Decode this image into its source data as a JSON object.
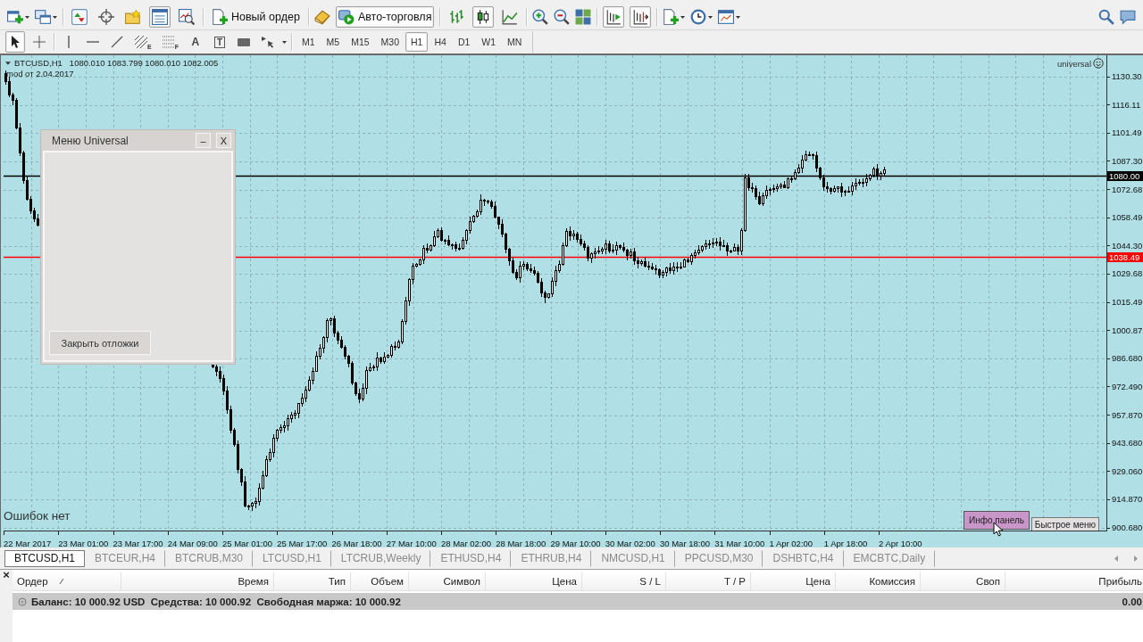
{
  "toolbar": {
    "view_toggles": [
      {
        "on": false
      },
      {
        "on": false
      },
      {
        "on": false
      },
      {
        "on": true
      },
      {
        "on": false
      }
    ],
    "new_order": "Новый ордер",
    "auto_trading": {
      "label": "Авто-торговля",
      "on": true
    },
    "chart_types": [
      {
        "selected": false
      },
      {
        "selected": true
      },
      {
        "selected": false
      }
    ],
    "autoscroll": {
      "on": true
    },
    "chart_shift": {
      "on": true
    }
  },
  "drawing_toolbar": {
    "tools": [
      {
        "selected": true
      },
      {
        "selected": false
      },
      {
        "selected": false
      },
      {
        "selected": false
      },
      {
        "selected": false
      },
      {
        "selected": false,
        "subscript": "E"
      },
      {
        "selected": false,
        "subscript": "F"
      },
      {
        "selected": false,
        "glyph": "A"
      },
      {
        "selected": false,
        "glyph": "T"
      },
      {
        "selected": false
      },
      {
        "selected": false
      }
    ],
    "timeframes": [
      {
        "label": "M1",
        "selected": false
      },
      {
        "label": "M5",
        "selected": false
      },
      {
        "label": "M15",
        "selected": false
      },
      {
        "label": "M30",
        "selected": false
      },
      {
        "label": "H1",
        "selected": true
      },
      {
        "label": "H4",
        "selected": false
      },
      {
        "label": "D1",
        "selected": false
      },
      {
        "label": "W1",
        "selected": false
      },
      {
        "label": "MN",
        "selected": false
      }
    ]
  },
  "chart": {
    "symbol": "BTCUSD,H1",
    "ohlc": "1080.010 1083.799 1080.010 1082.005",
    "comment": "mod от 2.04.2017",
    "expert": "universal",
    "status": "Ошибок нет",
    "panel": {
      "title": "Меню Universal",
      "minimize": "–",
      "close": "X",
      "button": "Закрыть отложки"
    },
    "buttons": [
      {
        "label": "Инфо панель",
        "color": "#c896c8"
      },
      {
        "label": "Быстрое меню",
        "color": "#e2e0e0"
      }
    ],
    "levels": [
      {
        "tag": "1080.00",
        "color": "#000000"
      },
      {
        "tag": "1038.49",
        "color": "#ff0000"
      }
    ],
    "price_labels": [
      "1130.30",
      "1116.11",
      "1101.49",
      "1087.30",
      "1072.68",
      "1058.49",
      "1044.30",
      "1029.68",
      "1015.49",
      "1000.87",
      "986.680",
      "972.490",
      "957.870",
      "943.680",
      "929.060",
      "914.870",
      "900.680"
    ],
    "time_labels": [
      "22 Mar 2017",
      "23 Mar 01:00",
      "23 Mar 17:00",
      "24 Mar 09:00",
      "25 Mar 01:00",
      "25 Mar 17:00",
      "26 Mar 18:00",
      "27 Mar 10:00",
      "28 Mar 02:00",
      "28 Mar 18:00",
      "29 Mar 10:00",
      "30 Mar 02:00",
      "30 Mar 18:00",
      "31 Mar 10:00",
      "1 Apr 02:00",
      "1 Apr 18:00",
      "2 Apr 10:00"
    ]
  },
  "chart_tabs": [
    {
      "label": "BTCUSD,H1",
      "selected": true
    },
    {
      "label": "BTCEUR,H4",
      "selected": false
    },
    {
      "label": "BTCRUB,M30",
      "selected": false
    },
    {
      "label": "LTCUSD,H1",
      "selected": false
    },
    {
      "label": "LTCRUB,Weekly",
      "selected": false
    },
    {
      "label": "ETHUSD,H4",
      "selected": false
    },
    {
      "label": "ETHRUB,H4",
      "selected": false
    },
    {
      "label": "NMCUSD,H1",
      "selected": false
    },
    {
      "label": "PPCUSD,M30",
      "selected": false
    },
    {
      "label": "DSHBTC,H4",
      "selected": false
    },
    {
      "label": "EMCBTC,Daily",
      "selected": false
    }
  ],
  "terminal": {
    "close": "×",
    "columns": [
      {
        "label": "Ордер",
        "sorted": true
      },
      {
        "label": "Время",
        "sorted": false
      },
      {
        "label": "Тип",
        "sorted": false
      },
      {
        "label": "Объем",
        "sorted": false
      },
      {
        "label": "Символ",
        "sorted": false
      },
      {
        "label": "Цена",
        "sorted": false
      },
      {
        "label": "S / L",
        "sorted": false
      },
      {
        "label": "T / P",
        "sorted": false
      },
      {
        "label": "Цена",
        "sorted": false
      },
      {
        "label": "Комиссия",
        "sorted": false
      },
      {
        "label": "Своп",
        "sorted": false
      },
      {
        "label": "Прибыль",
        "sorted": false
      }
    ],
    "balance": "Баланс: 10 000.92 USD  Средства: 10 000.92  Свободная маржа: 10 000.92",
    "profit": "0.00"
  }
}
